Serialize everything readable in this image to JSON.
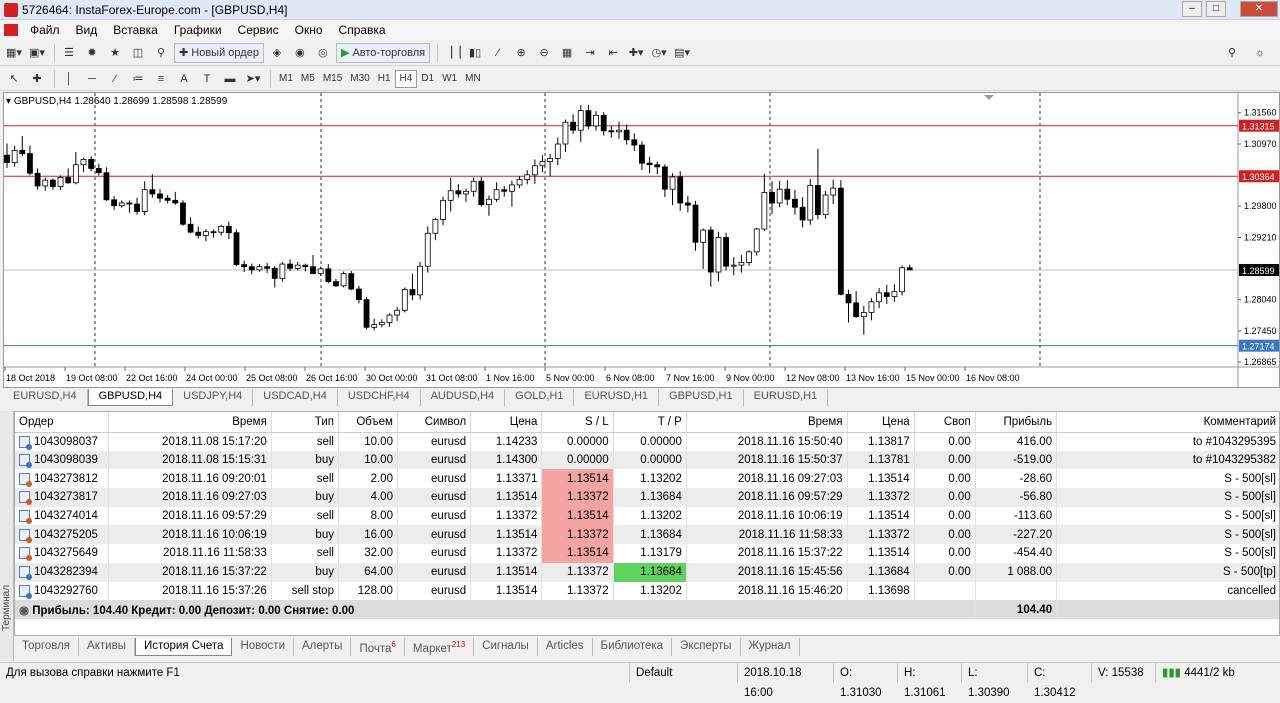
{
  "window": {
    "title": "5726464: InstaForex-Europe.com - [GBPUSD,H4]"
  },
  "menu": [
    "Файл",
    "Вид",
    "Вставка",
    "Графики",
    "Сервис",
    "Окно",
    "Справка"
  ],
  "toolbar": {
    "new_order": "Новый ордер",
    "autotrade": "Авто-торговля"
  },
  "timeframes": [
    "M1",
    "M5",
    "M15",
    "M30",
    "H1",
    "H4",
    "D1",
    "W1",
    "MN"
  ],
  "active_timeframe": "H4",
  "chart": {
    "header": "GBPUSD,H4  1.28640 1.28699 1.28598 1.28599",
    "price_labels": [
      "1.31560",
      "1.30970",
      "1.29800",
      "1.29210",
      "1.28040",
      "1.27450",
      "1.26865"
    ],
    "price_label_values": [
      1.3156,
      1.3097,
      1.298,
      1.2921,
      1.2804,
      1.2745,
      1.26865
    ],
    "hlines": [
      {
        "label": "1.31315",
        "value": 1.31315,
        "color": "#cc2222"
      },
      {
        "label": "1.30364",
        "value": 1.30364,
        "color": "#cc2222"
      },
      {
        "label": "1.27174",
        "value": 1.27174,
        "color": "#3a78c0"
      }
    ],
    "current_price": {
      "label": "1.28599",
      "value": 1.28599
    },
    "time_labels": [
      "18 Oct 2018",
      "19 Oct 08:00",
      "22 Oct 16:00",
      "24 Oct 00:00",
      "25 Oct 08:00",
      "26 Oct 16:00",
      "30 Oct 00:00",
      "31 Oct 08:00",
      "1 Nov 16:00",
      "5 Nov 00:00",
      "6 Nov 08:00",
      "7 Nov 16:00",
      "9 Nov 00:00",
      "12 Nov 08:00",
      "13 Nov 16:00",
      "15 Nov 00:00",
      "16 Nov 08:00"
    ],
    "candles": [
      [
        1.3076,
        1.3098,
        1.3052,
        1.3062
      ],
      [
        1.3062,
        1.3094,
        1.3054,
        1.3085
      ],
      [
        1.3085,
        1.3112,
        1.3074,
        1.3079
      ],
      [
        1.3079,
        1.3094,
        1.3038,
        1.3042
      ],
      [
        1.3042,
        1.3051,
        1.3011,
        1.3018
      ],
      [
        1.3018,
        1.3034,
        1.3009,
        1.3029
      ],
      [
        1.3029,
        1.3032,
        1.3011,
        1.3017
      ],
      [
        1.3017,
        1.3038,
        1.301,
        1.3034
      ],
      [
        1.3034,
        1.3051,
        1.3022,
        1.3024
      ],
      [
        1.3024,
        1.3082,
        1.3021,
        1.3058
      ],
      [
        1.3058,
        1.3071,
        1.3044,
        1.3068
      ],
      [
        1.3068,
        1.3074,
        1.3046,
        1.3051
      ],
      [
        1.3051,
        1.306,
        1.3038,
        1.3043
      ],
      [
        1.3043,
        1.3053,
        1.299,
        1.2992
      ],
      [
        1.2992,
        1.2999,
        1.2973,
        1.2981
      ],
      [
        1.2981,
        1.2991,
        1.2977,
        1.2986
      ],
      [
        1.2986,
        1.2991,
        1.2968,
        1.2984
      ],
      [
        1.2984,
        1.2996,
        1.2964,
        1.297
      ],
      [
        1.297,
        1.3027,
        1.2963,
        1.3011
      ],
      [
        1.3011,
        1.304,
        1.2996,
        1.3003
      ],
      [
        1.3003,
        1.3012,
        1.2987,
        1.2995
      ],
      [
        1.2995,
        1.3001,
        1.2985,
        1.2991
      ],
      [
        1.2991,
        1.3007,
        1.2983,
        1.2986
      ],
      [
        1.2986,
        1.2991,
        1.2943,
        1.2946
      ],
      [
        1.2946,
        1.2959,
        1.2929,
        1.2931
      ],
      [
        1.2931,
        1.2942,
        1.2919,
        1.2925
      ],
      [
        1.2925,
        1.2937,
        1.2914,
        1.2932
      ],
      [
        1.2932,
        1.2936,
        1.2921,
        1.2931
      ],
      [
        1.2931,
        1.2945,
        1.2925,
        1.2942
      ],
      [
        1.2942,
        1.2951,
        1.2918,
        1.293
      ],
      [
        1.293,
        1.2936,
        1.2867,
        1.287
      ],
      [
        1.287,
        1.2877,
        1.2856,
        1.2866
      ],
      [
        1.2866,
        1.2872,
        1.2852,
        1.286
      ],
      [
        1.286,
        1.2871,
        1.2856,
        1.2866
      ],
      [
        1.2866,
        1.2873,
        1.2854,
        1.2863
      ],
      [
        1.2863,
        1.2867,
        1.2827,
        1.2844
      ],
      [
        1.2844,
        1.2875,
        1.2838,
        1.2871
      ],
      [
        1.2871,
        1.288,
        1.2858,
        1.2863
      ],
      [
        1.2863,
        1.2875,
        1.2859,
        1.2869
      ],
      [
        1.2869,
        1.2872,
        1.2857,
        1.2866
      ],
      [
        1.2866,
        1.2888,
        1.2852,
        1.2853
      ],
      [
        1.2853,
        1.2866,
        1.2849,
        1.2862
      ],
      [
        1.2862,
        1.2871,
        1.2835,
        1.2838
      ],
      [
        1.2838,
        1.2843,
        1.2828,
        1.283
      ],
      [
        1.283,
        1.2857,
        1.2827,
        1.2853
      ],
      [
        1.2853,
        1.2858,
        1.2822,
        1.2824
      ],
      [
        1.2824,
        1.283,
        1.2797,
        1.2804
      ],
      [
        1.2804,
        1.2809,
        1.2748,
        1.2752
      ],
      [
        1.2752,
        1.2768,
        1.2746,
        1.2757
      ],
      [
        1.2757,
        1.2767,
        1.2752,
        1.2761
      ],
      [
        1.2761,
        1.2778,
        1.2753,
        1.2775
      ],
      [
        1.2775,
        1.279,
        1.2764,
        1.2784
      ],
      [
        1.2784,
        1.2827,
        1.278,
        1.2823
      ],
      [
        1.2823,
        1.2853,
        1.2803,
        1.2813
      ],
      [
        1.2813,
        1.2875,
        1.2804,
        1.2867
      ],
      [
        1.2867,
        1.2942,
        1.2855,
        1.2929
      ],
      [
        1.2929,
        1.2958,
        1.2916,
        1.2955
      ],
      [
        1.2955,
        1.2998,
        1.2944,
        1.2991
      ],
      [
        1.2991,
        1.3034,
        1.297,
        1.3009
      ],
      [
        1.3009,
        1.3022,
        1.2996,
        1.3003
      ],
      [
        1.3003,
        1.3013,
        1.2988,
        1.3008
      ],
      [
        1.3008,
        1.3034,
        1.2998,
        1.3027
      ],
      [
        1.3027,
        1.3035,
        1.2979,
        1.2983
      ],
      [
        1.2983,
        1.3,
        1.2962,
        1.2993
      ],
      [
        1.2993,
        1.3025,
        1.2988,
        1.3011
      ],
      [
        1.3011,
        1.3018,
        1.2998,
        1.3008
      ],
      [
        1.3008,
        1.3028,
        1.2979,
        1.302
      ],
      [
        1.302,
        1.3037,
        1.3014,
        1.303
      ],
      [
        1.303,
        1.3048,
        1.3021,
        1.3039
      ],
      [
        1.3039,
        1.3068,
        1.3022,
        1.3056
      ],
      [
        1.3056,
        1.3076,
        1.3044,
        1.3064
      ],
      [
        1.3064,
        1.3078,
        1.3036,
        1.307
      ],
      [
        1.307,
        1.3109,
        1.3057,
        1.3097
      ],
      [
        1.3097,
        1.3143,
        1.3082,
        1.3138
      ],
      [
        1.3138,
        1.3153,
        1.3116,
        1.3123
      ],
      [
        1.3123,
        1.317,
        1.3101,
        1.316
      ],
      [
        1.316,
        1.3171,
        1.3125,
        1.3131
      ],
      [
        1.3131,
        1.3159,
        1.3122,
        1.3151
      ],
      [
        1.3151,
        1.3157,
        1.3113,
        1.3122
      ],
      [
        1.3122,
        1.3131,
        1.3109,
        1.312
      ],
      [
        1.312,
        1.3139,
        1.3107,
        1.3123
      ],
      [
        1.3123,
        1.3134,
        1.3096,
        1.3105
      ],
      [
        1.3105,
        1.3117,
        1.3084,
        1.3095
      ],
      [
        1.3095,
        1.3102,
        1.3048,
        1.3061
      ],
      [
        1.3061,
        1.3073,
        1.3042,
        1.3058
      ],
      [
        1.3058,
        1.3064,
        1.304,
        1.3054
      ],
      [
        1.3054,
        1.3059,
        1.2997,
        1.3012
      ],
      [
        1.3012,
        1.3042,
        1.2982,
        1.3035
      ],
      [
        1.3035,
        1.3046,
        1.2971,
        1.2986
      ],
      [
        1.2986,
        1.2999,
        1.2968,
        1.2982
      ],
      [
        1.2982,
        1.299,
        1.2896,
        1.2912
      ],
      [
        1.2912,
        1.2938,
        1.2862,
        1.2935
      ],
      [
        1.2935,
        1.2942,
        1.2828,
        1.2856
      ],
      [
        1.2856,
        1.2932,
        1.2839,
        1.2921
      ],
      [
        1.2921,
        1.293,
        1.2859,
        1.2867
      ],
      [
        1.2867,
        1.2884,
        1.285,
        1.2869
      ],
      [
        1.2869,
        1.2888,
        1.2855,
        1.2874
      ],
      [
        1.2874,
        1.2897,
        1.2868,
        1.2894
      ],
      [
        1.2894,
        1.2939,
        1.2887,
        1.2937
      ],
      [
        1.2937,
        1.3041,
        1.2933,
        1.3006
      ],
      [
        1.3006,
        1.3027,
        1.2965,
        1.2986
      ],
      [
        1.2986,
        1.3028,
        1.2978,
        1.3012
      ],
      [
        1.3012,
        1.3029,
        1.2982,
        1.2993
      ],
      [
        1.2993,
        1.3011,
        1.2964,
        1.2978
      ],
      [
        1.2978,
        1.2997,
        1.294,
        1.2954
      ],
      [
        1.2954,
        1.3031,
        1.2945,
        1.3019
      ],
      [
        1.3019,
        1.3088,
        1.2955,
        1.2964
      ],
      [
        1.2964,
        1.3009,
        1.2956,
        1.3001
      ],
      [
        1.3001,
        1.303,
        1.2984,
        1.3014
      ],
      [
        1.3014,
        1.3029,
        1.2812,
        1.2814
      ],
      [
        1.2814,
        1.2823,
        1.2761,
        1.2798
      ],
      [
        1.2798,
        1.282,
        1.277,
        1.2772
      ],
      [
        1.2772,
        1.2792,
        1.2738,
        1.278
      ],
      [
        1.278,
        1.2807,
        1.2765,
        1.28
      ],
      [
        1.28,
        1.2826,
        1.2788,
        1.2817
      ],
      [
        1.2817,
        1.2832,
        1.2796,
        1.281
      ],
      [
        1.281,
        1.2833,
        1.28,
        1.2819
      ],
      [
        1.2819,
        1.2868,
        1.2812,
        1.2864
      ],
      [
        1.2864,
        1.287,
        1.286,
        1.286
      ]
    ]
  },
  "chart_tabs": [
    "EURUSD,H4",
    "GBPUSD,H4",
    "USDJPY,H4",
    "USDCAD,H4",
    "USDCHF,H4",
    "AUDUSD,H4",
    "GOLD,H1",
    "EURUSD,H1",
    "GBPUSD,H1",
    "EURUSD,H1"
  ],
  "active_chart_tab": "GBPUSD,H4",
  "history": {
    "columns": [
      "Ордер",
      "Время",
      "Тип",
      "Объем",
      "Символ",
      "Цена",
      "S / L",
      "T / P",
      "Время",
      "Цена",
      "Своп",
      "Прибыль",
      "Комментарий"
    ],
    "rows": [
      {
        "order": "1043098037",
        "time": "2018.11.08 15:17:20",
        "type": "sell",
        "volume": "10.00",
        "symbol": "eurusd",
        "price": "1.14233",
        "sl": "0.00000",
        "tp": "0.00000",
        "close_time": "2018.11.16 15:50:40",
        "close_price": "1.13817",
        "swap": "0.00",
        "profit": "416.00",
        "comment": "to #1043295395",
        "sl_hl": "",
        "tp_hl": "",
        "icon": "b"
      },
      {
        "order": "1043098039",
        "time": "2018.11.08 15:15:31",
        "type": "buy",
        "volume": "10.00",
        "symbol": "eurusd",
        "price": "1.14300",
        "sl": "0.00000",
        "tp": "0.00000",
        "close_time": "2018.11.16 15:50:37",
        "close_price": "1.13781",
        "swap": "0.00",
        "profit": "-519.00",
        "comment": "to #1043295382",
        "sl_hl": "",
        "tp_hl": "",
        "icon": "b"
      },
      {
        "order": "1043273812",
        "time": "2018.11.16 09:20:01",
        "type": "sell",
        "volume": "2.00",
        "symbol": "eurusd",
        "price": "1.13371",
        "sl": "1.13514",
        "tp": "1.13202",
        "close_time": "2018.11.16 09:27:03",
        "close_price": "1.13514",
        "swap": "0.00",
        "profit": "-28.60",
        "comment": "S - 500[sl]",
        "sl_hl": "red",
        "tp_hl": "",
        "icon": "r"
      },
      {
        "order": "1043273817",
        "time": "2018.11.16 09:27:03",
        "type": "buy",
        "volume": "4.00",
        "symbol": "eurusd",
        "price": "1.13514",
        "sl": "1.13372",
        "tp": "1.13684",
        "close_time": "2018.11.16 09:57:29",
        "close_price": "1.13372",
        "swap": "0.00",
        "profit": "-56.80",
        "comment": "S - 500[sl]",
        "sl_hl": "red",
        "tp_hl": "",
        "icon": "r"
      },
      {
        "order": "1043274014",
        "time": "2018.11.16 09:57:29",
        "type": "sell",
        "volume": "8.00",
        "symbol": "eurusd",
        "price": "1.13372",
        "sl": "1.13514",
        "tp": "1.13202",
        "close_time": "2018.11.16 10:06:19",
        "close_price": "1.13514",
        "swap": "0.00",
        "profit": "-113.60",
        "comment": "S - 500[sl]",
        "sl_hl": "red",
        "tp_hl": "",
        "icon": "r"
      },
      {
        "order": "1043275205",
        "time": "2018.11.16 10:06:19",
        "type": "buy",
        "volume": "16.00",
        "symbol": "eurusd",
        "price": "1.13514",
        "sl": "1.13372",
        "tp": "1.13684",
        "close_time": "2018.11.16 11:58:33",
        "close_price": "1.13372",
        "swap": "0.00",
        "profit": "-227.20",
        "comment": "S - 500[sl]",
        "sl_hl": "red",
        "tp_hl": "",
        "icon": "r"
      },
      {
        "order": "1043275649",
        "time": "2018.11.16 11:58:33",
        "type": "sell",
        "volume": "32.00",
        "symbol": "eurusd",
        "price": "1.13372",
        "sl": "1.13514",
        "tp": "1.13179",
        "close_time": "2018.11.16 15:37:22",
        "close_price": "1.13514",
        "swap": "0.00",
        "profit": "-454.40",
        "comment": "S - 500[sl]",
        "sl_hl": "red",
        "tp_hl": "",
        "icon": "r"
      },
      {
        "order": "1043282394",
        "time": "2018.11.16 15:37:22",
        "type": "buy",
        "volume": "64.00",
        "symbol": "eurusd",
        "price": "1.13514",
        "sl": "1.13372",
        "tp": "1.13684",
        "close_time": "2018.11.16 15:45:56",
        "close_price": "1.13684",
        "swap": "0.00",
        "profit": "1 088.00",
        "comment": "S - 500[tp]",
        "sl_hl": "",
        "tp_hl": "green",
        "icon": "b"
      },
      {
        "order": "1043292760",
        "time": "2018.11.16 15:37:26",
        "type": "sell stop",
        "volume": "128.00",
        "symbol": "eurusd",
        "price": "1.13514",
        "sl": "1.13372",
        "tp": "1.13202",
        "close_time": "2018.11.16 15:46:20",
        "close_price": "1.13698",
        "swap": "",
        "profit": "",
        "comment": "cancelled",
        "sl_hl": "",
        "tp_hl": "",
        "icon": "b"
      }
    ],
    "summary": "Прибыль: 104.40  Кредит: 0.00  Депозит: 0.00  Снятие: 0.00",
    "summary_profit": "104.40"
  },
  "terminal_label": "Терминал",
  "terminal_tabs": [
    {
      "label": "Торговля",
      "badge": ""
    },
    {
      "label": "Активы",
      "badge": ""
    },
    {
      "label": "История Счета",
      "badge": ""
    },
    {
      "label": "Новости",
      "badge": ""
    },
    {
      "label": "Алерты",
      "badge": ""
    },
    {
      "label": "Почта",
      "badge": "6"
    },
    {
      "label": "Маркет",
      "badge": "213"
    },
    {
      "label": "Сигналы",
      "badge": ""
    },
    {
      "label": "Articles",
      "badge": ""
    },
    {
      "label": "Библиотека",
      "badge": ""
    },
    {
      "label": "Эксперты",
      "badge": ""
    },
    {
      "label": "Журнал",
      "badge": ""
    }
  ],
  "active_terminal_tab": "История Счета",
  "status": {
    "help": "Для вызова справки нажмите F1",
    "profile": "Default",
    "datetime": "2018.10.18 16:00",
    "open": "O: 1.31030",
    "high": "H: 1.31061",
    "low": "L: 1.30390",
    "close": "C: 1.30412",
    "volume": "V: 15538",
    "traffic": "4441/2 kb"
  }
}
